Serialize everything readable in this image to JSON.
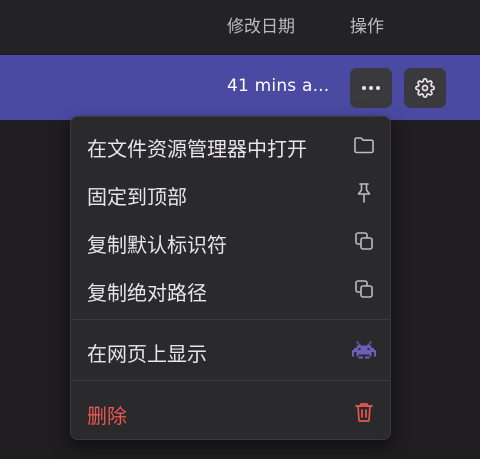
{
  "header": {
    "date_column": "修改日期",
    "ops_column": "操作"
  },
  "row": {
    "modified": "41 mins a..."
  },
  "buttons": {
    "more_icon": "more-horizontal-icon",
    "settings_icon": "gear-icon"
  },
  "menu": {
    "items": [
      {
        "label": "在文件资源管理器中打开",
        "icon": "folder-icon"
      },
      {
        "label": "固定到顶部",
        "icon": "pin-icon"
      },
      {
        "label": "复制默认标识符",
        "icon": "copy-icon"
      },
      {
        "label": "复制绝对路径",
        "icon": "copy-icon"
      },
      {
        "label": "在网页上显示",
        "icon": "alien-invader-icon"
      },
      {
        "label": "删除",
        "icon": "trash-icon"
      }
    ]
  },
  "colors": {
    "background": "#1f1d1f",
    "selected_row": "#4a4aa3",
    "menu_bg": "#2a292c",
    "danger": "#e8584f",
    "accent_icon": "#6c5fb8"
  }
}
